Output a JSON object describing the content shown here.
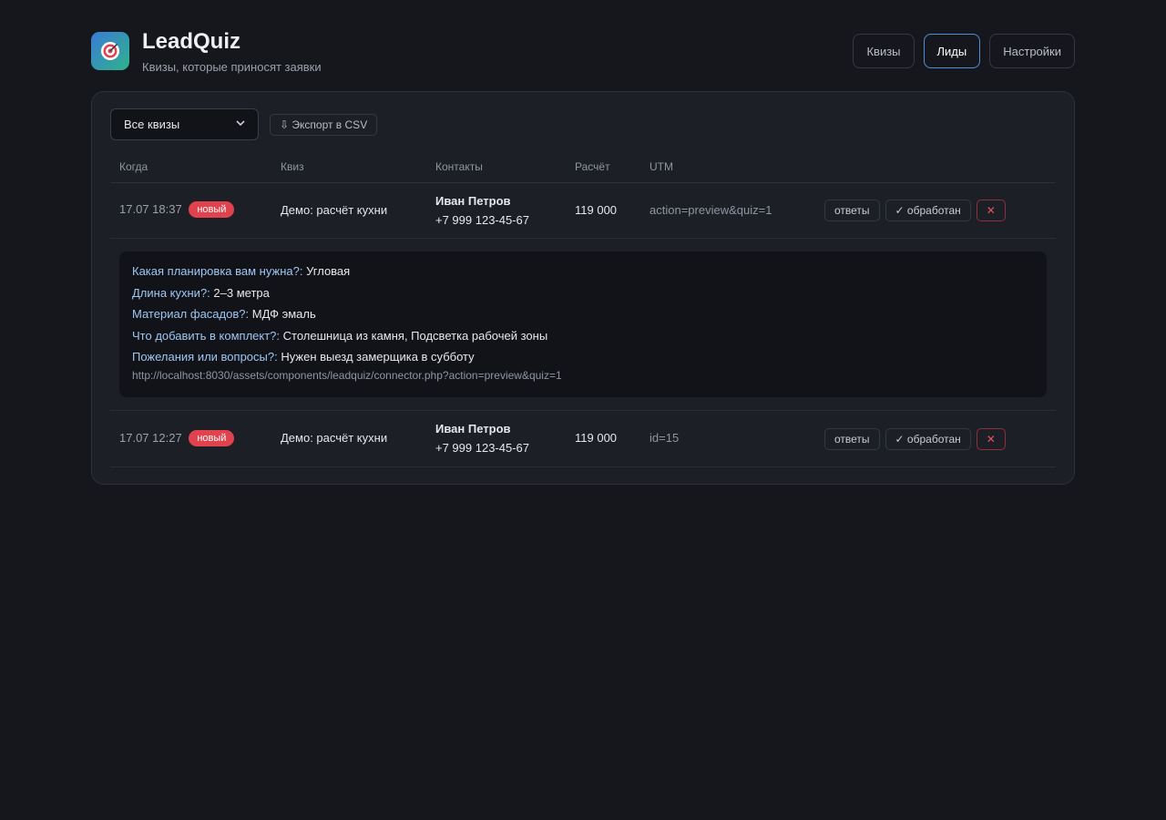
{
  "app": {
    "logo_icon": "target-icon",
    "title": "LeadQuiz",
    "subtitle": "Квизы, которые приносят заявки"
  },
  "nav": [
    {
      "label": "Квизы",
      "active": false
    },
    {
      "label": "Лиды",
      "active": true
    },
    {
      "label": "Настройки",
      "active": false
    }
  ],
  "toolbar": {
    "filter_value": "Все квизы",
    "export_label": "⇩ Экспорт в CSV"
  },
  "table": {
    "headers": [
      "Когда",
      "Квиз",
      "Контакты",
      "Расчёт",
      "UTM"
    ],
    "rows": [
      {
        "when": "17.07 18:37",
        "badge": "новый",
        "quiz": "Демо: расчёт кухни",
        "name": "Иван Петров",
        "phone": "+7 999 123-45-67",
        "calc": "119 000",
        "utm": "action=preview&quiz=1",
        "btn_answers": "ответы",
        "btn_done": "✓ обработан",
        "btn_delete": "✕"
      },
      {
        "when": "17.07 12:27",
        "badge": "новый",
        "quiz": "Демо: расчёт кухни",
        "name": "Иван Петров",
        "phone": "+7 999 123-45-67",
        "calc": "119 000",
        "utm": "id=15",
        "btn_answers": "ответы",
        "btn_done": "✓ обработан",
        "btn_delete": "✕"
      }
    ]
  },
  "answers": {
    "items": [
      {
        "q": "Какая планировка вам нужна?:",
        "a": "Угловая"
      },
      {
        "q": "Длина кухни?:",
        "a": "2–3 метра"
      },
      {
        "q": "Материал фасадов?:",
        "a": "МДФ эмаль"
      },
      {
        "q": "Что добавить в комплект?:",
        "a": "Столешница из камня, Подсветка рабочей зоны"
      },
      {
        "q": "Пожелания или вопросы?:",
        "a": "Нужен выезд замерщика в субботу"
      }
    ],
    "url": "http://localhost:8030/assets/components/leadquiz/connector.php?action=preview&quiz=1"
  },
  "colors": {
    "background": "#16171c",
    "card": "#1d1f26",
    "accent": "#4d8fd6",
    "badge": "#e0434e",
    "question": "#9ec7f2"
  }
}
